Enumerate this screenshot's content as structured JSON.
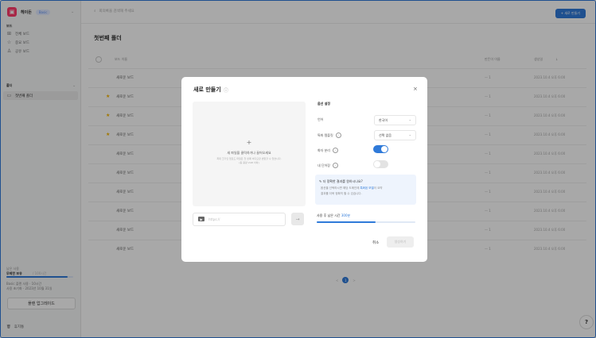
{
  "workspace": {
    "name": "헤이든",
    "badge": "Basic"
  },
  "sidebar": {
    "section1": "보드",
    "items": [
      {
        "icon": "grid-icon",
        "glyph": "⊞",
        "label": "전체 보드"
      },
      {
        "icon": "star-icon",
        "glyph": "☆",
        "label": "중요 보드"
      },
      {
        "icon": "people-icon",
        "glyph": "♙",
        "label": "공유 보드"
      }
    ],
    "section2": "폴더",
    "folder": {
      "icon": "folder-icon",
      "glyph": "▭",
      "label": "첫번째 폴더"
    },
    "usage": {
      "label": "남은 사용",
      "value": "무제한 보유",
      "sub": "/ 100시간",
      "fill_fraction": 0.92,
      "line1": "Basic 플랜 사용 · 10시간",
      "line2": "사용 초기화 · 2023년 10월 31일"
    },
    "upgrade": "플랜 업그레이드",
    "trash": "휴지통"
  },
  "topbar": {
    "search_placeholder": "회의록을 검색해 주세요",
    "new_button": "+ 새로 만들기"
  },
  "page": {
    "title": "첫번째 폴더",
    "columns": {
      "name": "보드 이름",
      "owner": "만든이 이름",
      "date": "생성일"
    },
    "sort_icon": "↓",
    "rows": [
      {
        "name": "새로운 보드",
        "starred": false,
        "owner": "— 1",
        "date": "2023.10.4 오후 6:00"
      },
      {
        "name": "새로운 보드",
        "starred": true,
        "owner": "— 1",
        "date": "2023.10.4 오후 6:00"
      },
      {
        "name": "새로운 보드",
        "starred": true,
        "owner": "— 1",
        "date": "2023.10.4 오후 6:00"
      },
      {
        "name": "새로운 보드",
        "starred": true,
        "owner": "— 1",
        "date": "2023.10.4 오후 6:00"
      },
      {
        "name": "새로운 보드",
        "starred": false,
        "owner": "— 1",
        "date": "2023.10.4 오후 6:00"
      },
      {
        "name": "새로운 보드",
        "starred": false,
        "owner": "— 1",
        "date": "2023.10.4 오후 6:00"
      },
      {
        "name": "새로운 보드",
        "starred": false,
        "owner": "— 1",
        "date": "2023.10.4 오후 6:00"
      },
      {
        "name": "새로운 보드",
        "starred": false,
        "owner": "— 1",
        "date": "2023.10.4 오후 6:00"
      },
      {
        "name": "새로운 보드",
        "starred": false,
        "owner": "— 1",
        "date": "2023.10.4 오후 6:00"
      },
      {
        "name": "새로운 보드",
        "starred": false,
        "owner": "— 1",
        "date": "2023.10.4 오후 6:00"
      }
    ],
    "pagination": {
      "prev": "<",
      "current": "1",
      "next": ">"
    }
  },
  "help": "?",
  "modal": {
    "title": "새로 만들기",
    "info_icon": "ⓘ",
    "close": "×",
    "upload": {
      "plus": "+",
      "main": "새 파일을 클릭하거나 끌어오세요",
      "sub1": "최대 크기인 업로드 파일은 첫 번째 비디오만 변환할 수 있습니다.",
      "sub2": "(총 용량 2GB 이하)"
    },
    "url_icon": "▶",
    "url_placeholder": "https://",
    "url_go": "→",
    "options": {
      "header": "옵션 설정",
      "language_label": "언어",
      "language_value": "한국어",
      "template_label": "특화 템플릿",
      "template_value": "선택 없음",
      "speaker_label": "화자 분리",
      "speaker_on": true,
      "summary_label": "내 단어장",
      "summary_on": false
    },
    "tip": {
      "title": "더 정확한 결과를 원하시나요?",
      "line1_pre": "옵션을 선택하시면 해당 도메인에 ",
      "line1_link": "특화된 모델",
      "line1_post": "이 요약",
      "line2": "결과를 더욱 정확히 할 수 있습니다."
    },
    "remaining_label": "사용 후 남은 시간",
    "remaining_value": "300분",
    "remaining_fraction": 0.6,
    "cancel": "취소",
    "generate": "생성하기"
  },
  "colors": {
    "accent": "#2f7ad9",
    "logo": "#ff3b6b",
    "star": "#f5b400"
  }
}
